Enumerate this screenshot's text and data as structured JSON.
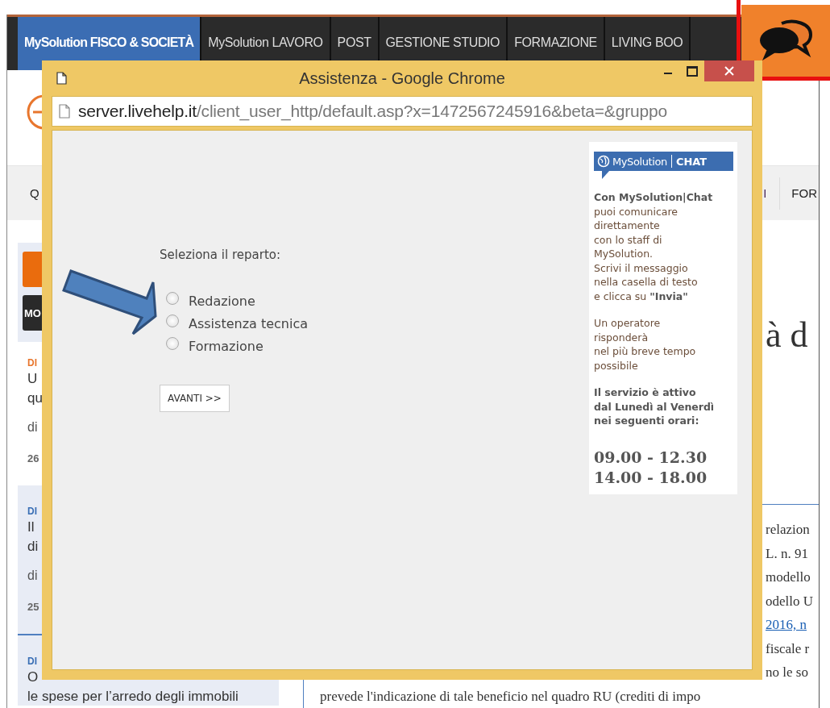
{
  "site_nav": {
    "tabs": [
      {
        "label": "MySolution FISCO & SOCIETÀ",
        "selected": true
      },
      {
        "label": "MySolution LAVORO",
        "selected": false
      },
      {
        "label": "POST",
        "selected": false
      },
      {
        "label": "GESTIONE STUDIO",
        "selected": false
      },
      {
        "label": "FORMAZIONE",
        "selected": false
      },
      {
        "label": "LIVING BOO",
        "selected": false
      }
    ]
  },
  "menu_bar": {
    "items": [
      {
        "label": "Q"
      },
      {
        "label": "I"
      },
      {
        "label": "FOR"
      }
    ]
  },
  "sidebar": {
    "badge": "MO",
    "articles": [
      {
        "category": "DI",
        "color": "#e8762d",
        "highlighted": false,
        "title_lines": [
          "U",
          "qu"
        ],
        "author": "di",
        "date": "26"
      },
      {
        "category": "DI",
        "color": "#3a6fb5",
        "highlighted": true,
        "title_lines": [
          "Il",
          "di"
        ],
        "author": "di",
        "date": "25"
      },
      {
        "category": "DI",
        "color": "#3a6fb5",
        "highlighted": true,
        "title_lines": [
          "O",
          "le spese per l’arredo degli immobili"
        ]
      }
    ]
  },
  "article": {
    "heading": "à d",
    "lines": [
      {
        "text": "relazion",
        "link": false
      },
      {
        "text": "L. n. 91",
        "link": false
      },
      {
        "text": "modello",
        "link": false
      },
      {
        "text": "odello U",
        "link": false
      },
      {
        "text": "2016, n",
        "link": true
      },
      {
        "text": "fiscale r",
        "link": false
      },
      {
        "text": "no le so",
        "link": false
      }
    ],
    "last_line": "prevede l'indicazione di tale beneficio nel quadro RU (crediti di impo"
  },
  "popup": {
    "title": "Assistenza - Google Chrome",
    "url_host": "server.livehelp.it",
    "url_path": "/client_user_http/default.asp?x=1472567245916&beta=&gruppo",
    "prompt": "Seleziona il reparto:",
    "options": [
      {
        "label": "Redazione",
        "selected": false
      },
      {
        "label": "Assistenza tecnica",
        "selected": false
      },
      {
        "label": "Formazione",
        "selected": false
      }
    ],
    "button": "AVANTI >>",
    "info": {
      "logo_left": "MySolution",
      "logo_right": "CHAT",
      "paragraphs": [
        [
          "**Con MySolution|Chat**",
          "puoi comunicare",
          "direttamente",
          "con lo staff di",
          "MySolution.",
          "Scrivi il messaggio",
          "nella casella di testo",
          "e clicca su **\"Invia\"**"
        ],
        [
          "Un operatore",
          "risponderà",
          "nel più breve tempo",
          "possibile"
        ],
        [
          "**Il servizio è attivo**",
          "**dal Lunedì al Venerdì**",
          "**nei seguenti orari:**"
        ]
      ],
      "hours": [
        "09.00 - 12.30",
        "14.00 - 18.00"
      ]
    }
  }
}
